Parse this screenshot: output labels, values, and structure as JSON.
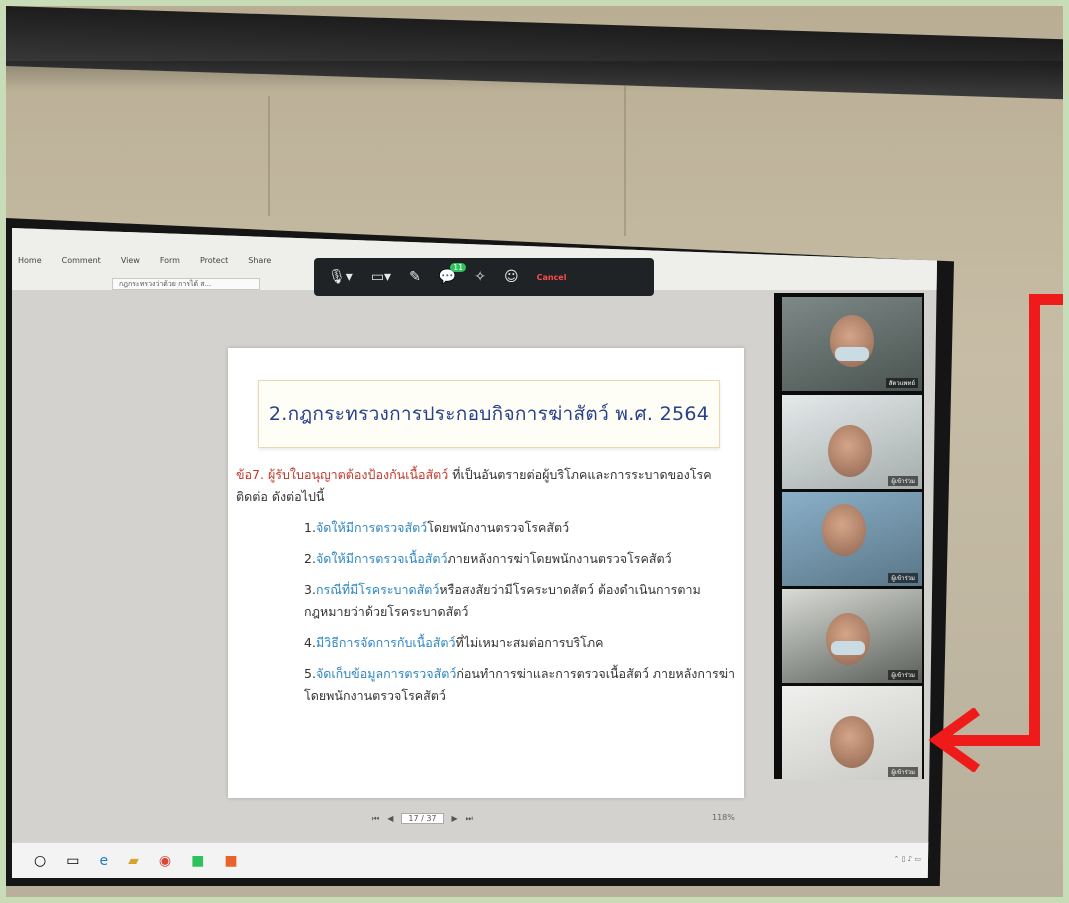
{
  "zoom_app": {
    "ribbon_menu": [
      "Home",
      "Comment",
      "View",
      "Form",
      "Protect",
      "Share"
    ],
    "document_tab": "กฎกระทรวงว่าด้วย การได้ ส...",
    "toolbar_cancel": "Cancel",
    "chat_badge_count": "11"
  },
  "slide": {
    "title": "2.กฎกระทรวงการประกอบกิจการฆ่าสัตว์ พ.ศ. 2564",
    "clause_label": "ข้อ7. ผู้รับใบอนุญาตต้องป้องกันเนื้อสัตว์",
    "clause_rest": " ที่เป็นอันตรายต่อผู้บริโภคและการระบาดของโรคติดต่อ  ดังต่อไปนี้",
    "items": [
      {
        "num": "1.",
        "highlight": "จัดให้มีการตรวจสัตว์",
        "rest": "โดยพนักงานตรวจโรคสัตว์"
      },
      {
        "num": "2.",
        "highlight": "จัดให้มีการตรวจเนื้อสัตว์",
        "rest": "ภายหลังการฆ่าโดยพนักงานตรวจโรคสัตว์"
      },
      {
        "num": "3.",
        "highlight": "กรณีที่มีโรคระบาดสัตว์",
        "rest": "หรือสงสัยว่ามีโรคระบาดสัตว์ ต้องดำเนินการตามกฎหมายว่าด้วยโรคระบาดสัตว์"
      },
      {
        "num": "4.",
        "highlight": "มีวิธีการจัดการกับเนื้อสัตว์",
        "rest": "ที่ไม่เหมาะสมต่อการบริโภค"
      },
      {
        "num": "5.",
        "highlight": "จัดเก็บข้อมูลการตรวจสัตว์",
        "rest": "ก่อนทำการฆ่าและการตรวจเนื้อสัตว์ ภายหลังการฆ่า โดยพนักงานตรวจโรคสัตว์"
      }
    ]
  },
  "viewer": {
    "page_box": "17 / 37",
    "zoom_level": "118%"
  },
  "participants": [
    {
      "name": "สัตวแพทย์"
    },
    {
      "name": "ผู้เข้าร่วม"
    },
    {
      "name": "ผู้เข้าร่วม"
    },
    {
      "name": "ผู้เข้าร่วม"
    },
    {
      "name": "ผู้เข้าร่วม"
    }
  ],
  "colors": {
    "annotation_arrow": "#ef1a1a",
    "slide_title": "#27408b",
    "highlight_blue": "#2e86c1",
    "clause_red": "#c0392b"
  }
}
